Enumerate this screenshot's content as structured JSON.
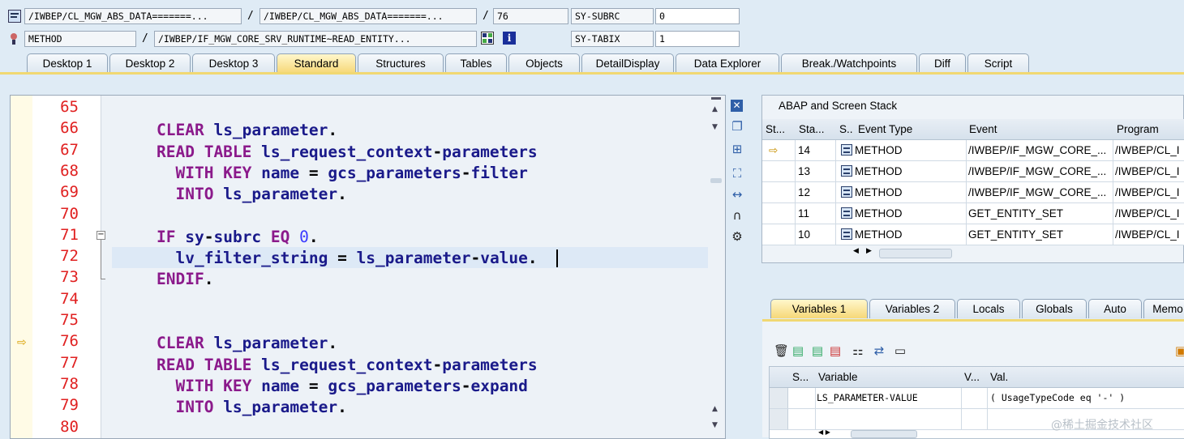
{
  "top": {
    "row1": {
      "program": "/IWBEP/CL_MGW_ABS_DATA=======...",
      "include": "/IWBEP/CL_MGW_ABS_DATA=======...",
      "line": "76",
      "sysvar_label": "SY-SUBRC",
      "sysvar_value": "0"
    },
    "row2": {
      "type": "METHOD",
      "name": "/IWBEP/IF_MGW_CORE_SRV_RUNTIME~READ_ENTITY...",
      "sysvar_label": "SY-TABIX",
      "sysvar_value": "1"
    },
    "sep": "/"
  },
  "tabs": [
    "Desktop 1",
    "Desktop 2",
    "Desktop 3",
    "Standard",
    "Structures",
    "Tables",
    "Objects",
    "DetailDisplay",
    "Data Explorer",
    "Break./Watchpoints",
    "Diff",
    "Script"
  ],
  "active_tab": "Standard",
  "editor": {
    "lines": [
      {
        "n": "65",
        "tokens": []
      },
      {
        "n": "66",
        "tokens": [
          [
            "kw",
            "CLEAR "
          ],
          [
            "id",
            "ls_parameter"
          ],
          [
            "op",
            "."
          ]
        ]
      },
      {
        "n": "67",
        "tokens": [
          [
            "kw",
            "READ TABLE "
          ],
          [
            "id",
            "ls_request_context"
          ],
          [
            "op",
            "-"
          ],
          [
            "id",
            "parameters"
          ]
        ]
      },
      {
        "n": "68",
        "tokens": [
          [
            "op",
            "  "
          ],
          [
            "kw",
            "WITH KEY "
          ],
          [
            "id",
            "name "
          ],
          [
            "op",
            "= "
          ],
          [
            "id",
            "gcs_parameters"
          ],
          [
            "op",
            "-"
          ],
          [
            "id",
            "filter"
          ]
        ]
      },
      {
        "n": "69",
        "tokens": [
          [
            "op",
            "  "
          ],
          [
            "kw",
            "INTO "
          ],
          [
            "id",
            "ls_parameter"
          ],
          [
            "op",
            "."
          ]
        ]
      },
      {
        "n": "70",
        "tokens": []
      },
      {
        "n": "71",
        "tokens": [
          [
            "kw",
            "IF "
          ],
          [
            "id",
            "sy"
          ],
          [
            "op",
            "-"
          ],
          [
            "id",
            "subrc "
          ],
          [
            "kw",
            "EQ "
          ],
          [
            "num",
            "0"
          ],
          [
            "op",
            "."
          ]
        ]
      },
      {
        "n": "72",
        "tokens": [
          [
            "op",
            "  "
          ],
          [
            "id",
            "lv_filter_string "
          ],
          [
            "op",
            "= "
          ],
          [
            "id",
            "ls_parameter"
          ],
          [
            "op",
            "-"
          ],
          [
            "id",
            "value"
          ],
          [
            "op",
            "."
          ]
        ]
      },
      {
        "n": "73",
        "tokens": [
          [
            "kw",
            "ENDIF"
          ],
          [
            "op",
            "."
          ]
        ]
      },
      {
        "n": "74",
        "tokens": []
      },
      {
        "n": "75",
        "tokens": []
      },
      {
        "n": "76",
        "tokens": [
          [
            "kw",
            "CLEAR "
          ],
          [
            "id",
            "ls_parameter"
          ],
          [
            "op",
            "."
          ]
        ]
      },
      {
        "n": "77",
        "tokens": [
          [
            "kw",
            "READ TABLE "
          ],
          [
            "id",
            "ls_request_context"
          ],
          [
            "op",
            "-"
          ],
          [
            "id",
            "parameters"
          ]
        ]
      },
      {
        "n": "78",
        "tokens": [
          [
            "op",
            "  "
          ],
          [
            "kw",
            "WITH KEY "
          ],
          [
            "id",
            "name "
          ],
          [
            "op",
            "= "
          ],
          [
            "id",
            "gcs_parameters"
          ],
          [
            "op",
            "-"
          ],
          [
            "id",
            "expand"
          ]
        ]
      },
      {
        "n": "79",
        "tokens": [
          [
            "op",
            "  "
          ],
          [
            "kw",
            "INTO "
          ],
          [
            "id",
            "ls_parameter"
          ],
          [
            "op",
            "."
          ]
        ]
      },
      {
        "n": "80",
        "tokens": []
      }
    ],
    "current_line": "76",
    "highlight_line": "72"
  },
  "stack": {
    "title": "ABAP and Screen Stack",
    "headers": [
      "St...",
      "Sta...",
      "S..",
      "Event Type",
      "Event",
      "Program"
    ],
    "rows": [
      {
        "marker": "⇨",
        "level": "14",
        "type": "METHOD",
        "event": "/IWBEP/IF_MGW_CORE_...",
        "program": "/IWBEP/CL_I"
      },
      {
        "marker": "",
        "level": "13",
        "type": "METHOD",
        "event": "/IWBEP/IF_MGW_CORE_...",
        "program": "/IWBEP/CL_I"
      },
      {
        "marker": "",
        "level": "12",
        "type": "METHOD",
        "event": "/IWBEP/IF_MGW_CORE_...",
        "program": "/IWBEP/CL_I"
      },
      {
        "marker": "",
        "level": "11",
        "type": "METHOD",
        "event": "GET_ENTITY_SET",
        "program": "/IWBEP/CL_I"
      },
      {
        "marker": "",
        "level": "10",
        "type": "METHOD",
        "event": "GET_ENTITY_SET",
        "program": "/IWBEP/CL_I"
      }
    ]
  },
  "var_tabs": [
    "Variables 1",
    "Variables 2",
    "Locals",
    "Globals",
    "Auto",
    "Memo"
  ],
  "active_var_tab": "Variables 1",
  "vars": {
    "headers": [
      "S...",
      "Variable",
      "V...",
      "Val."
    ],
    "rows": [
      {
        "variable": "LS_PARAMETER-VALUE",
        "value": "( UsageTypeCode eq '-' )"
      },
      {
        "variable": "",
        "value": ""
      }
    ]
  },
  "watermark": "@稀土掘金技术社区",
  "colors": {
    "accent_tab": "#f6d878",
    "line_numbers": "#e02020",
    "keyword": "#8b1a8b",
    "identifier": "#1a1a8a"
  }
}
